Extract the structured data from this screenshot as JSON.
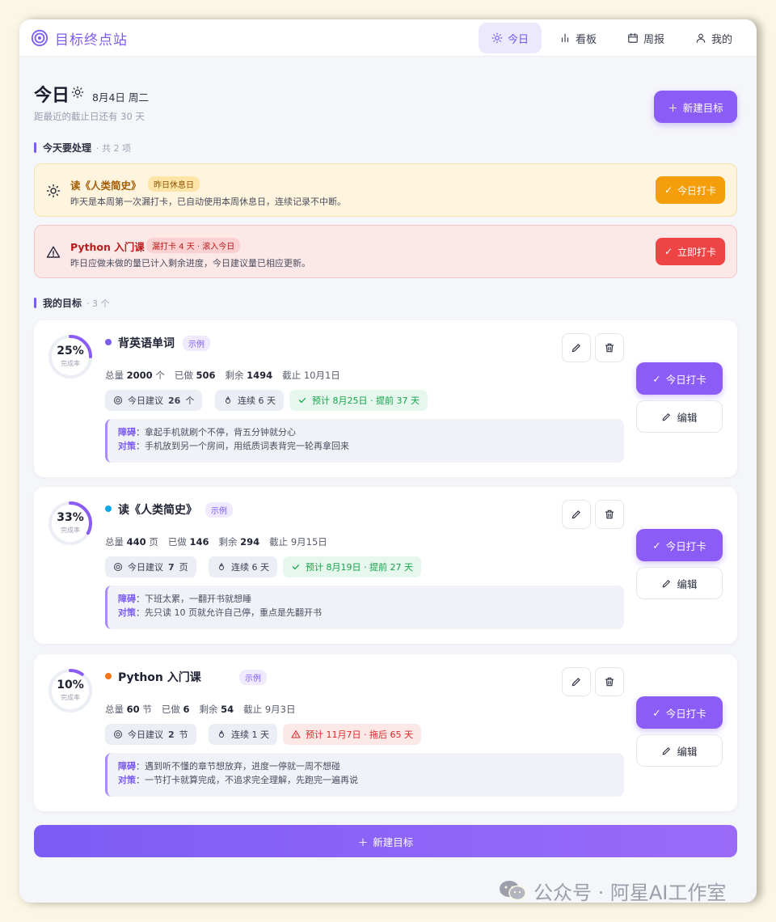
{
  "app": {
    "title": "目标终点站"
  },
  "nav": [
    {
      "label": "今日",
      "icon": "sun-icon",
      "active": true
    },
    {
      "label": "看板",
      "icon": "bar-chart-icon",
      "active": false
    },
    {
      "label": "周报",
      "icon": "calendar-icon",
      "active": false
    },
    {
      "label": "我的",
      "icon": "user-icon",
      "active": false
    }
  ],
  "header": {
    "title": "今日",
    "date": "8月4日 周二",
    "subtitle": "距最近的截止日还有 30 天",
    "new_goal_label": "新建目标"
  },
  "todo": {
    "title": "今天要处理",
    "count": "· 共 2 项",
    "alerts": [
      {
        "type": "warning",
        "title": "读《人类简史》",
        "badge": "昨日休息日",
        "desc": "昨天是本周第一次漏打卡，已自动使用本周休息日，连续记录不中断。",
        "button": "今日打卡",
        "color": "#f59e0b"
      },
      {
        "type": "error",
        "title": "Python 入门课",
        "badge": "漏打卡 4 天 · 滚入今日",
        "desc": "昨日应做未做的量已计入剩余进度，今日建议量已相应更新。",
        "button": "立即打卡",
        "color": "#ef4444"
      }
    ]
  },
  "goals_section": {
    "title": "我的目标",
    "count": "· 3 个"
  },
  "goals": [
    {
      "name": "背英语单词",
      "tag": "示例",
      "dot_color": "#7c5cf0",
      "progress": 0.25,
      "pct_label": "25%",
      "ring_label": "完成率",
      "stats": [
        {
          "k": "总量",
          "v": "2000",
          "u": "个"
        },
        {
          "k": "已做",
          "v": "506",
          "u": ""
        },
        {
          "k": "剩余",
          "v": "1494",
          "u": ""
        },
        {
          "k": "截止",
          "v": "",
          "u": "10月1日"
        }
      ],
      "suggest_label": "今日建议",
      "suggest_value": "26",
      "suggest_unit": "个",
      "streak": "连续 6 天",
      "forecast": "预计 8月25日 · 提前 37 天",
      "forecast_status": "ahead",
      "obstacle_k": "障碍",
      "obstacle": "拿起手机就刷个不停，背五分钟就分心",
      "strategy_k": "对策",
      "strategy": "手机放到另一个房间，用纸质词表背完一轮再拿回来",
      "check_label": "今日打卡",
      "edit_label": "编辑"
    },
    {
      "name": "读《人类简史》",
      "tag": "示例",
      "dot_color": "#0ea5e9",
      "progress": 0.33,
      "pct_label": "33%",
      "ring_label": "完成率",
      "stats": [
        {
          "k": "总量",
          "v": "440",
          "u": "页"
        },
        {
          "k": "已做",
          "v": "146",
          "u": ""
        },
        {
          "k": "剩余",
          "v": "294",
          "u": ""
        },
        {
          "k": "截止",
          "v": "",
          "u": "9月15日"
        }
      ],
      "suggest_label": "今日建议",
      "suggest_value": "7",
      "suggest_unit": "页",
      "streak": "连续 6 天",
      "forecast": "预计 8月19日 · 提前 27 天",
      "forecast_status": "ahead",
      "obstacle_k": "障碍",
      "obstacle": "下班太累，一翻开书就想睡",
      "strategy_k": "对策",
      "strategy": "先只读 10 页就允许自己停，重点是先翻开书",
      "check_label": "今日打卡",
      "edit_label": "编辑"
    },
    {
      "name": "Python 入门课",
      "tag": "示例",
      "dot_color": "#f97316",
      "progress": 0.1,
      "pct_label": "10%",
      "ring_label": "完成率",
      "stats": [
        {
          "k": "总量",
          "v": "60",
          "u": "节"
        },
        {
          "k": "已做",
          "v": "6",
          "u": ""
        },
        {
          "k": "剩余",
          "v": "54",
          "u": ""
        },
        {
          "k": "截止",
          "v": "",
          "u": "9月3日"
        }
      ],
      "suggest_label": "今日建议",
      "suggest_value": "2",
      "suggest_unit": "节",
      "streak": "连续 1 天",
      "forecast": "预计 11月7日 · 拖后 65 天",
      "forecast_status": "behind",
      "obstacle_k": "障碍",
      "obstacle": "遇到听不懂的章节想放弃，进度一停就一周不想碰",
      "strategy_k": "对策",
      "strategy": "一节打卡就算完成，不追求完全理解，先跑完一遍再说",
      "check_label": "今日打卡",
      "edit_label": "编辑"
    }
  ],
  "footer": {
    "new_goal_label": "新建目标"
  },
  "watermark": "公众号 · 阿星AI工作室"
}
